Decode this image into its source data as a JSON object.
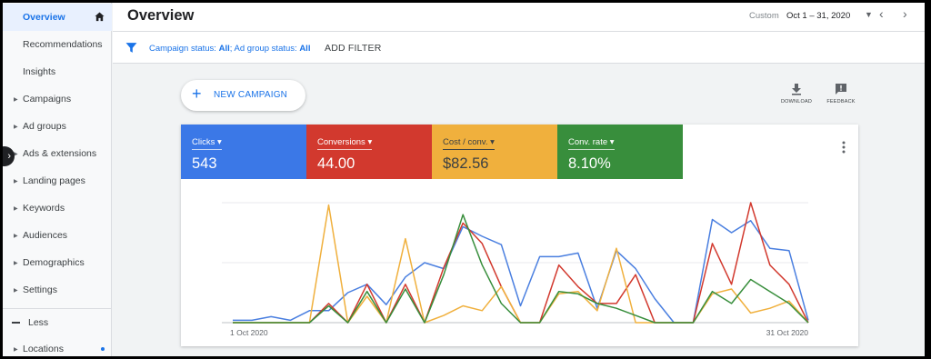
{
  "sidebar": {
    "items": [
      {
        "label": "Overview"
      },
      {
        "label": "Recommendations"
      },
      {
        "label": "Insights"
      },
      {
        "label": "Campaigns"
      },
      {
        "label": "Ad groups"
      },
      {
        "label": "Ads & extensions"
      },
      {
        "label": "Landing pages"
      },
      {
        "label": "Keywords"
      },
      {
        "label": "Audiences"
      },
      {
        "label": "Demographics"
      },
      {
        "label": "Settings"
      }
    ],
    "less_label": "Less",
    "locations_label": "Locations"
  },
  "header": {
    "title": "Overview",
    "date_custom": "Custom",
    "date_range": "Oct 1 – 31, 2020"
  },
  "filters": {
    "campaign_status_label": "Campaign status:",
    "campaign_status_value": "All",
    "ad_group_status_label": "Ad group status:",
    "ad_group_status_value": "All",
    "add_filter_label": "ADD FILTER"
  },
  "actions": {
    "new_campaign_label": "NEW CAMPAIGN",
    "download_label": "DOWNLOAD",
    "feedback_label": "FEEDBACK"
  },
  "metrics": [
    {
      "label": "Clicks",
      "value": "543",
      "color": "#3b78e7"
    },
    {
      "label": "Conversions",
      "value": "44.00",
      "color": "#d2392e"
    },
    {
      "label": "Cost / conv.",
      "value": "$82.56",
      "color": "#f0b03d"
    },
    {
      "label": "Conv. rate",
      "value": "8.10%",
      "color": "#388e3c"
    }
  ],
  "chart_data": {
    "type": "line",
    "x_start_label": "1 Oct 2020",
    "x_end_label": "31 Oct 2020",
    "x": [
      1,
      2,
      3,
      4,
      5,
      6,
      7,
      8,
      9,
      10,
      11,
      12,
      13,
      14,
      15,
      16,
      17,
      18,
      19,
      20,
      21,
      22,
      23,
      24,
      25,
      26,
      27,
      28,
      29,
      30,
      31
    ],
    "ylim": [
      0,
      1
    ],
    "grid": true,
    "series": [
      {
        "name": "Clicks",
        "color": "#4a7fe0",
        "values": [
          0.02,
          0.02,
          0.05,
          0.02,
          0.1,
          0.1,
          0.25,
          0.32,
          0.15,
          0.38,
          0.5,
          0.45,
          0.8,
          0.72,
          0.65,
          0.14,
          0.55,
          0.55,
          0.58,
          0.12,
          0.6,
          0.45,
          0.2,
          0.0,
          0.0,
          0.86,
          0.75,
          0.85,
          0.62,
          0.6,
          0.02
        ]
      },
      {
        "name": "Conversions",
        "color": "#d2392e",
        "values": [
          0.0,
          0.0,
          0.0,
          0.0,
          0.0,
          0.16,
          0.0,
          0.32,
          0.0,
          0.32,
          0.0,
          0.46,
          0.83,
          0.66,
          0.3,
          0.0,
          0.0,
          0.48,
          0.3,
          0.16,
          0.16,
          0.4,
          0.0,
          0.0,
          0.0,
          0.66,
          0.32,
          1.0,
          0.48,
          0.32,
          0.0
        ]
      },
      {
        "name": "Cost / conv.",
        "color": "#f0b03d",
        "values": [
          0.0,
          0.0,
          0.0,
          0.0,
          0.0,
          0.98,
          0.0,
          0.22,
          0.0,
          0.7,
          0.0,
          0.06,
          0.14,
          0.1,
          0.3,
          0.0,
          0.0,
          0.24,
          0.26,
          0.1,
          0.62,
          0.0,
          0.0,
          0.0,
          0.0,
          0.24,
          0.28,
          0.08,
          0.12,
          0.18,
          0.0
        ]
      },
      {
        "name": "Conv. rate",
        "color": "#388e3c",
        "values": [
          0.0,
          0.0,
          0.0,
          0.0,
          0.0,
          0.14,
          0.0,
          0.26,
          0.0,
          0.28,
          0.0,
          0.4,
          0.9,
          0.48,
          0.16,
          0.0,
          0.0,
          0.26,
          0.24,
          0.16,
          0.12,
          0.06,
          0.0,
          0.0,
          0.0,
          0.26,
          0.16,
          0.36,
          0.26,
          0.16,
          0.0
        ]
      }
    ]
  }
}
